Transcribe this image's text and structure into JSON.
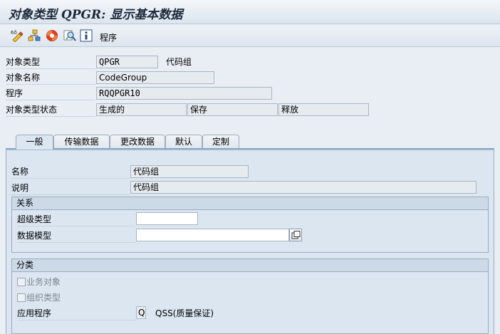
{
  "window": {
    "title": "对象类型 QPGR: 显示基本数据"
  },
  "toolbar": {
    "icons": [
      "display-change-icon",
      "hierarchy-icon",
      "help-lifebuoy-icon",
      "find-icon",
      "info-icon"
    ],
    "program_label": "程序"
  },
  "header": {
    "object_type_label": "对象类型",
    "object_type_value": "QPGR",
    "object_type_desc": "代码组",
    "object_name_label": "对象名称",
    "object_name_value": "CodeGroup",
    "program_label": "程序",
    "program_value": "RQQPGR10",
    "status_label": "对象类型状态",
    "status_generated": "生成的",
    "status_saved": "保存",
    "status_released": "释放"
  },
  "tabs": [
    {
      "label": "一般",
      "active": true
    },
    {
      "label": "传输数据",
      "active": false
    },
    {
      "label": "更改数据",
      "active": false
    },
    {
      "label": "默认",
      "active": false
    },
    {
      "label": "定制",
      "active": false
    }
  ],
  "general": {
    "name_label": "名称",
    "name_value": "代码组",
    "description_label": "说明",
    "description_value": "代码组"
  },
  "relations": {
    "title": "关系",
    "supertype_label": "超级类型",
    "supertype_value": "",
    "data_model_label": "数据模型",
    "data_model_value": ""
  },
  "classification": {
    "title": "分类",
    "business_object_label": "业务对象",
    "business_object_checked": false,
    "org_type_label": "组织类型",
    "org_type_checked": false,
    "application_label": "应用程序",
    "application_code": "Q",
    "application_desc": "QSS(质量保证)"
  }
}
